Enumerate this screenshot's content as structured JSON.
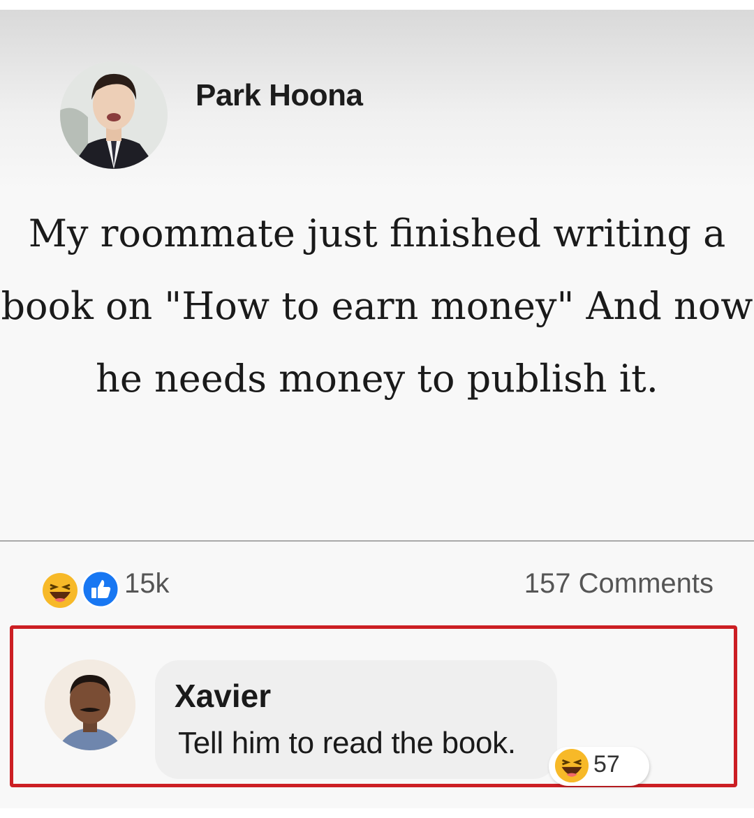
{
  "post": {
    "author": "Park Hoona",
    "text": "My roommate just finished writing a book on \"How to earn money\" And now he needs money to publish it.",
    "reactions": {
      "icons": [
        "haha-icon",
        "like-icon"
      ],
      "count": "15k"
    },
    "comments_count": "157 Comments"
  },
  "comment": {
    "author": "Xavier",
    "text": "Tell him to read the book.",
    "reaction_icon": "haha-icon",
    "reaction_count": "57"
  },
  "colors": {
    "highlight_border": "#cc1f24",
    "like_blue": "#1877f2",
    "haha_yellow": "#f7b928"
  }
}
